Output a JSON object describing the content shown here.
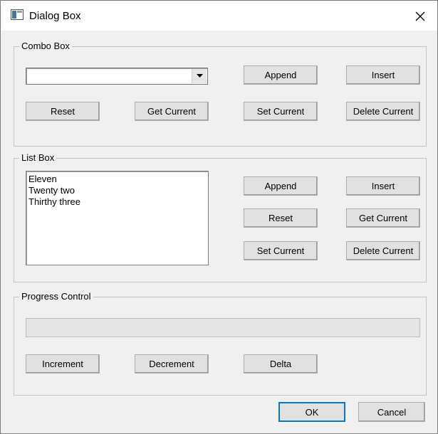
{
  "window": {
    "title": "Dialog Box",
    "close_icon": "close-icon"
  },
  "combo_group": {
    "label": "Combo Box",
    "combo_value": "",
    "buttons": {
      "append": "Append",
      "insert": "Insert",
      "reset": "Reset",
      "get_current": "Get Current",
      "set_current": "Set Current",
      "delete_current": "Delete Current"
    }
  },
  "list_group": {
    "label": "List Box",
    "items": [
      "Eleven",
      "Twenty two",
      "Thirthy three"
    ],
    "buttons": {
      "append": "Append",
      "insert": "Insert",
      "reset": "Reset",
      "get_current": "Get Current",
      "set_current": "Set Current",
      "delete_current": "Delete Current"
    }
  },
  "progress_group": {
    "label": "Progress Control",
    "progress_fraction": 0,
    "buttons": {
      "increment": "Increment",
      "decrement": "Decrement",
      "delta": "Delta"
    }
  },
  "footer": {
    "ok": "OK",
    "cancel": "Cancel"
  },
  "colors": {
    "progress_fill": "#06b025",
    "default_button_border": "#0078d7"
  }
}
